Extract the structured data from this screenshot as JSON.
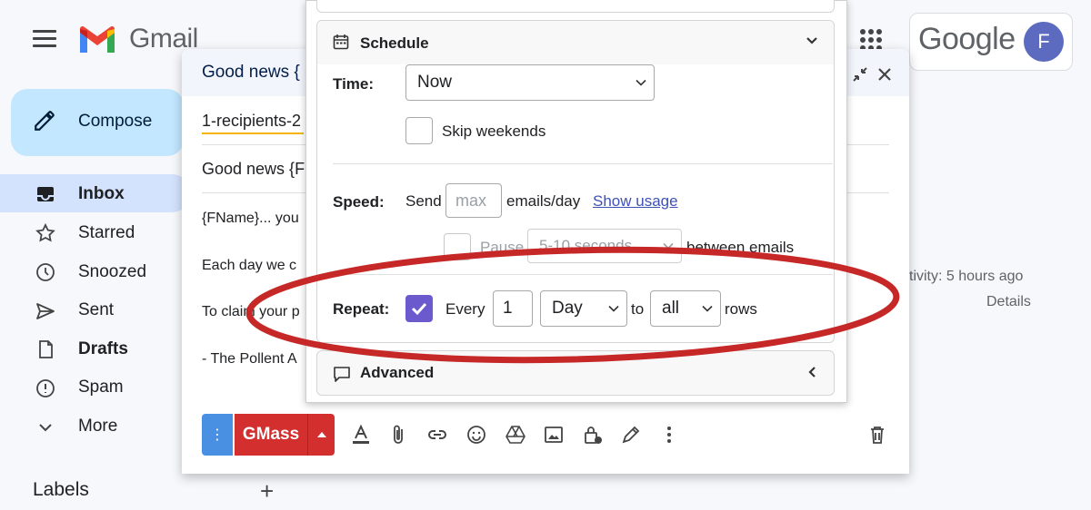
{
  "gmail": {
    "logo_text": "Gmail",
    "google_word": "Google",
    "avatar_letter": "F",
    "compose_label": "Compose",
    "nav": [
      {
        "label": "Inbox",
        "icon": "inbox-icon",
        "active": true,
        "bold": true
      },
      {
        "label": "Starred",
        "icon": "star-icon",
        "active": false,
        "bold": false
      },
      {
        "label": "Snoozed",
        "icon": "clock-icon",
        "active": false,
        "bold": false
      },
      {
        "label": "Sent",
        "icon": "send-icon",
        "active": false,
        "bold": false
      },
      {
        "label": "Drafts",
        "icon": "draft-icon",
        "active": false,
        "bold": true
      },
      {
        "label": "Spam",
        "icon": "spam-icon",
        "active": false,
        "bold": false
      },
      {
        "label": "More",
        "icon": "chevron-down-icon",
        "active": false,
        "bold": false
      }
    ],
    "labels_heading": "Labels",
    "activity_text": "ctivity: 5 hours ago",
    "details_text": "Details"
  },
  "compose": {
    "title": "Good news {",
    "to_value": "1-recipients-2",
    "subject_value": "Good news {F",
    "body_lines": [
      "{FName}... you",
      "Each day we c",
      "To claim your p",
      "- The Pollent A"
    ],
    "dots_label": "⋮",
    "gmass_label": "GMass"
  },
  "schedule": {
    "title": "Schedule",
    "time_label": "Time:",
    "time_value": "Now",
    "skip_weekends_label": "Skip weekends",
    "speed_label": "Speed:",
    "send_label": "Send",
    "max_placeholder": "max",
    "emails_per_day_label": "emails/day",
    "show_usage_label": "Show usage",
    "pause_label": "Pause",
    "pause_value": "5-10 seconds",
    "between_emails_label": "between emails",
    "repeat_label": "Repeat:",
    "every_label": "Every",
    "repeat_count": "1",
    "repeat_unit": "Day",
    "to_label": "to",
    "rows_value": "all",
    "rows_label": "rows"
  },
  "advanced": {
    "title": "Advanced"
  },
  "colors": {
    "accent_purple": "#6a5acd",
    "gmass_red": "#d32f2f",
    "oval_red": "#c62828",
    "link_blue": "#3f51b5"
  }
}
